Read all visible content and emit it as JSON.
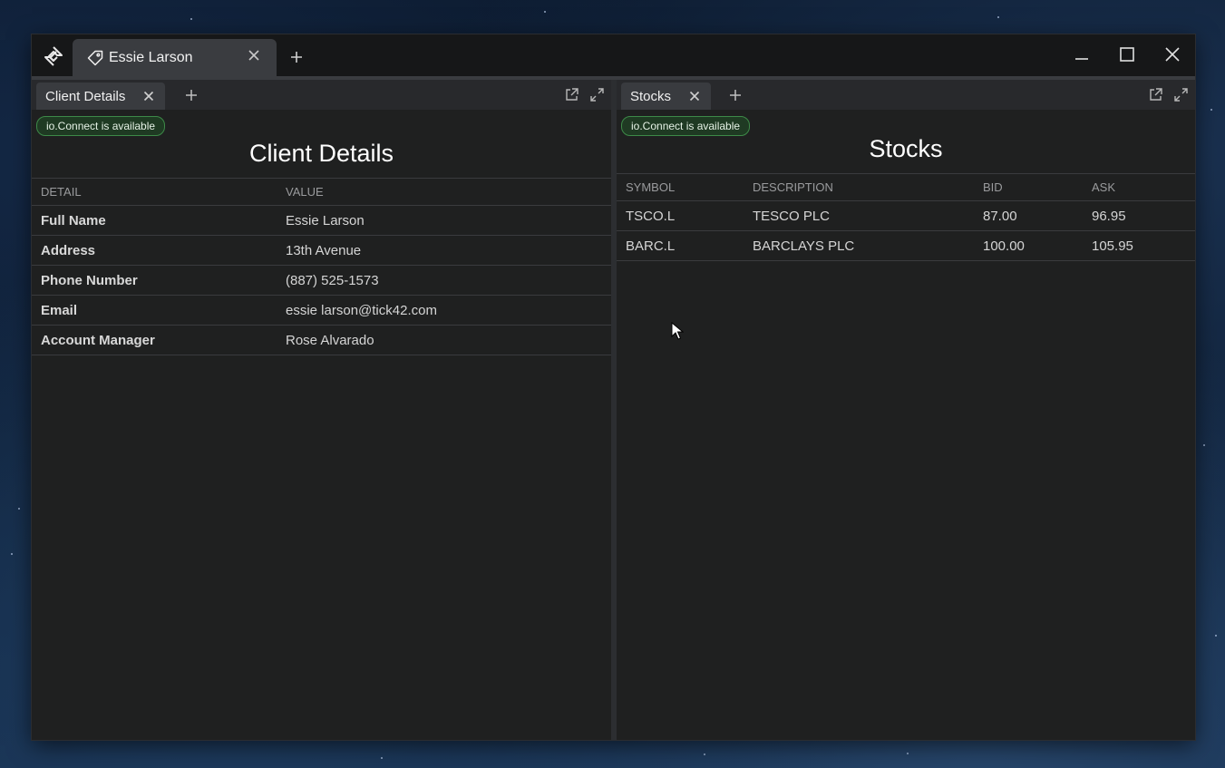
{
  "window": {
    "tab_title": "Essie Larson",
    "icons": [
      "app-logo-icon",
      "tag-icon",
      "close-icon",
      "plus-icon",
      "minimize-icon",
      "maximize-icon",
      "close-window-icon"
    ]
  },
  "left_pane": {
    "tab_label": "Client Details",
    "badge": "io.Connect is available",
    "title": "Client Details",
    "columns": [
      "DETAIL",
      "VALUE"
    ],
    "rows": [
      {
        "detail": "Full Name",
        "value": "Essie Larson"
      },
      {
        "detail": "Address",
        "value": "13th Avenue"
      },
      {
        "detail": "Phone Number",
        "value": "(887) 525-1573"
      },
      {
        "detail": "Email",
        "value": "essie larson@tick42.com"
      },
      {
        "detail": "Account Manager",
        "value": "Rose Alvarado"
      }
    ]
  },
  "right_pane": {
    "tab_label": "Stocks",
    "badge": "io.Connect is available",
    "title": "Stocks",
    "columns": [
      "SYMBOL",
      "DESCRIPTION",
      "BID",
      "ASK"
    ],
    "rows": [
      {
        "symbol": "TSCO.L",
        "description": "TESCO PLC",
        "bid": "87.00",
        "ask": "96.95"
      },
      {
        "symbol": "BARC.L",
        "description": "BARCLAYS PLC",
        "bid": "100.00",
        "ask": "105.95"
      }
    ]
  },
  "colors": {
    "badge_border": "#3d8a48",
    "background": "#1f2020"
  }
}
